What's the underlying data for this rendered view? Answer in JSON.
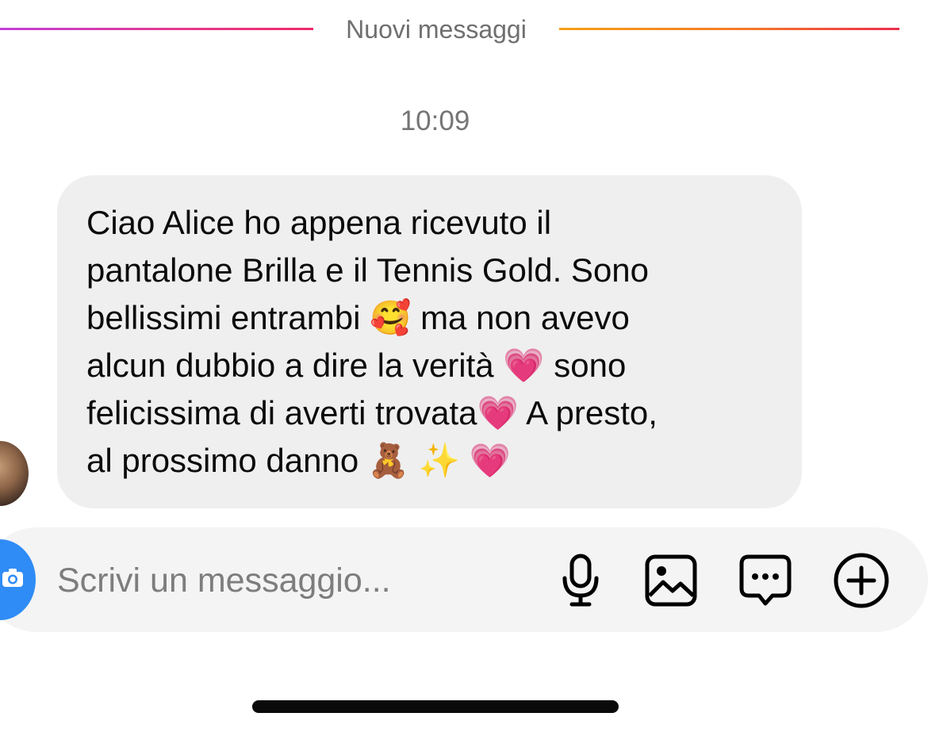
{
  "divider": {
    "label": "Nuovi messaggi"
  },
  "thread": {
    "timestamp": "10:09",
    "message": {
      "text": "Ciao Alice ho appena ricevuto il\npantalone Brilla e il Tennis Gold. Sono\nbellissimi entrambi 🥰 ma non avevo\nalcun dubbio a dire la verità 💗 sono\nfelicissima di averti trovata💗 A presto,\nal prossimo danno 🧸 ✨ 💗"
    }
  },
  "composer": {
    "placeholder": "Scrivi un messaggio...",
    "value": "",
    "icons": {
      "camera": "camera-icon",
      "microphone": "microphone-icon",
      "gallery": "gallery-icon",
      "sticker": "chat-bubble-icon",
      "more": "plus-circle-icon"
    }
  },
  "colors": {
    "accent_blue": "#2f8cf6",
    "bubble_bg": "#efefef",
    "composer_bg": "#f4f4f4",
    "divider_left_start": "#c23fd9",
    "divider_left_end": "#ee2a6a",
    "divider_right_start": "#f5a018",
    "divider_right_end": "#ec2e4e"
  }
}
